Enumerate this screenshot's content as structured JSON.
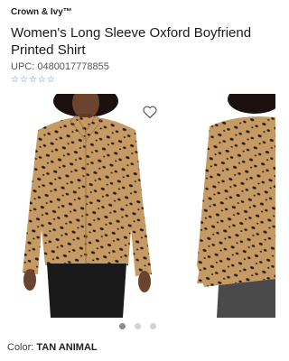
{
  "brand": "Crown & Ivy™",
  "product": {
    "title": "Women's Long Sleeve Oxford Boyfriend Printed Shirt",
    "upc": "UPC: 0480017778855",
    "rating_stars": 5,
    "rating_value": 0
  },
  "gallery": {
    "active_index": 0,
    "count": 3
  },
  "color": {
    "label": "Color: ",
    "value": "TAN ANIMAL"
  },
  "icons": {
    "favorite": "heart-icon",
    "star": "star-outline-icon"
  },
  "colors": {
    "shirt": "#c59a64",
    "spots": "#2a1e14",
    "star": "#5a7fb5"
  }
}
